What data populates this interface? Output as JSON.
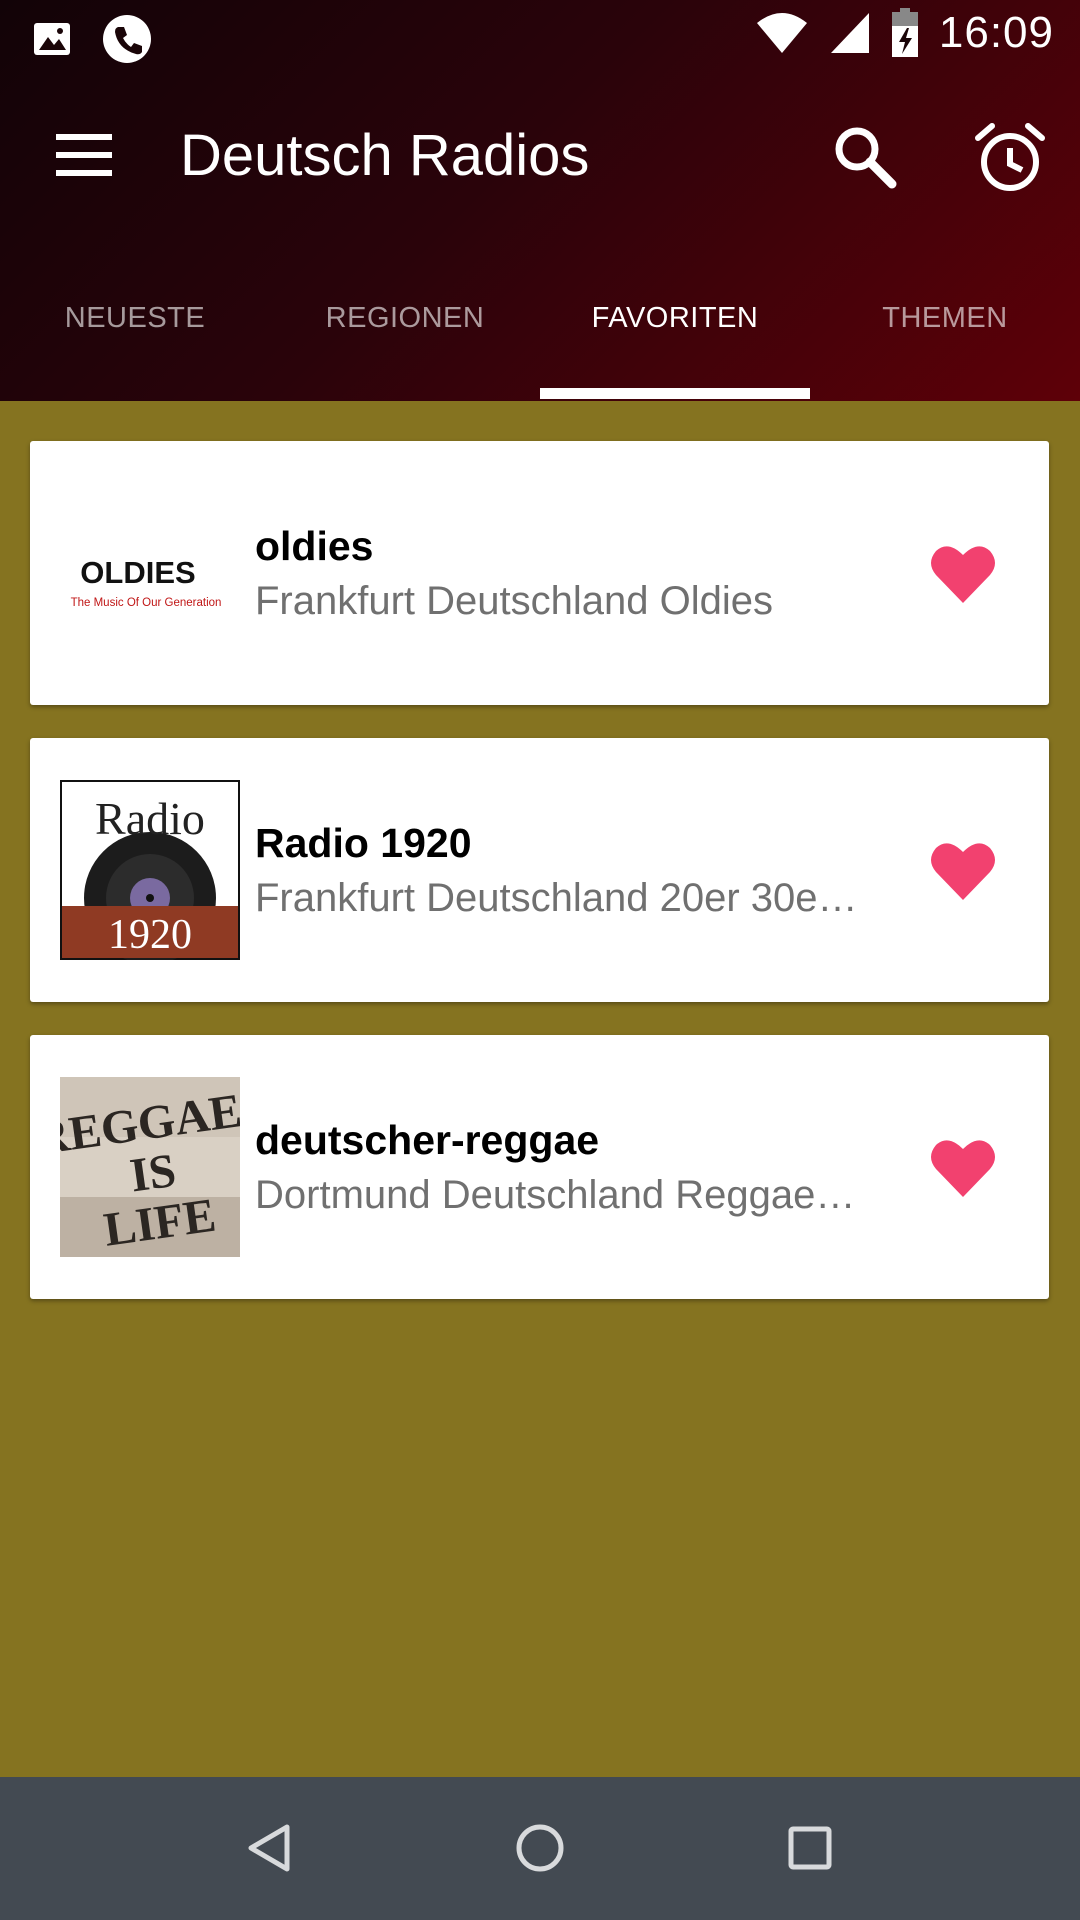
{
  "status_bar": {
    "time": "16:09",
    "left_icons": [
      "image-icon",
      "phone-icon"
    ],
    "right_icons": [
      "wifi-icon",
      "signal-icon",
      "battery-icon"
    ]
  },
  "toolbar": {
    "title": "Deutsch Radios",
    "icons": [
      "menu-icon",
      "search-icon",
      "alarm-icon"
    ]
  },
  "tabs": [
    {
      "label": "NEUESTE",
      "active": false
    },
    {
      "label": "REGIONEN",
      "active": false
    },
    {
      "label": "FAVORITEN",
      "active": true
    },
    {
      "label": "THEMEN",
      "active": false
    }
  ],
  "stations": [
    {
      "name": "oldies",
      "subtitle": "Frankfurt Deutschland Oldies",
      "logo": {
        "line1": "OLDIES",
        "line2": "The Music Of Our Generation"
      },
      "favorite": true
    },
    {
      "name": "Radio 1920",
      "subtitle": "Frankfurt Deutschland 20er 30e…",
      "logo": {
        "line1": "Radio",
        "line2": "1920"
      },
      "favorite": true
    },
    {
      "name": "deutscher-reggae",
      "subtitle": "Dortmund Deutschland Reggae…",
      "logo": {
        "line1": "REGGAE",
        "line2": "IS",
        "line3": "LIFE"
      },
      "favorite": true
    }
  ],
  "colors": {
    "background": "#857320",
    "heart": "#f2416f",
    "navbar": "#434a52"
  },
  "nav_bar": {
    "icons": [
      "back-icon",
      "home-icon",
      "recents-icon"
    ]
  }
}
